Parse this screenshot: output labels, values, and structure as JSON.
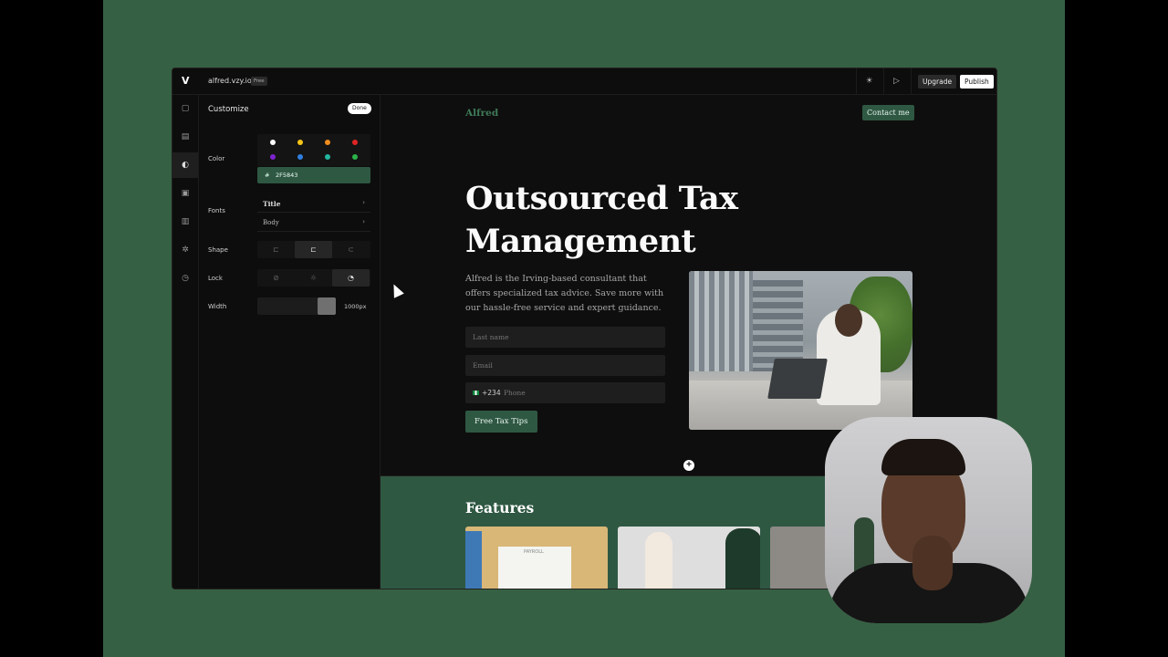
{
  "topbar": {
    "logo": "V",
    "site_url": "alfred.vzy.io",
    "plan_badge": "Free",
    "upgrade_label": "Upgrade",
    "publish_label": "Publish",
    "theme_icon": "sun-icon",
    "preview_icon": "play-icon"
  },
  "rail": {
    "items": [
      {
        "icon": "page-icon"
      },
      {
        "icon": "document-icon"
      },
      {
        "icon": "palette-icon",
        "active": true
      },
      {
        "icon": "image-icon"
      },
      {
        "icon": "chart-icon"
      },
      {
        "icon": "gear-icon"
      },
      {
        "icon": "clock-icon"
      }
    ]
  },
  "customize": {
    "title": "Customize",
    "done_label": "Done",
    "color_label": "Color",
    "swatches": [
      "#ffffff",
      "#f5c518",
      "#f08c1e",
      "#e02424",
      "#7e22ce",
      "#2f7fe0",
      "#22b6a0",
      "#2bb34a"
    ],
    "hex_prefix": "#",
    "hex_value": "2F5843",
    "fonts_label": "Fonts",
    "font_title": "Title",
    "font_body": "Body",
    "shape_label": "Shape",
    "lock_label": "Lock",
    "width_label": "Width",
    "width_value": "1000px"
  },
  "site": {
    "brand": "Alfred",
    "contact_label": "Contact me",
    "hero_title": "Outsourced Tax Management",
    "hero_desc": "Alfred is the Irving-based consultant that offers specialized tax advice. Save more with our hassle-free service and expert guidance.",
    "lastname_placeholder": "Last name",
    "email_placeholder": "Email",
    "dial_code": "+234",
    "phone_placeholder": "Phone",
    "cta_label": "Free Tax Tips",
    "features_title": "Features",
    "card1_label": "PAYROLL"
  },
  "colors": {
    "accent": "#2F5843",
    "stage": "#366043"
  }
}
